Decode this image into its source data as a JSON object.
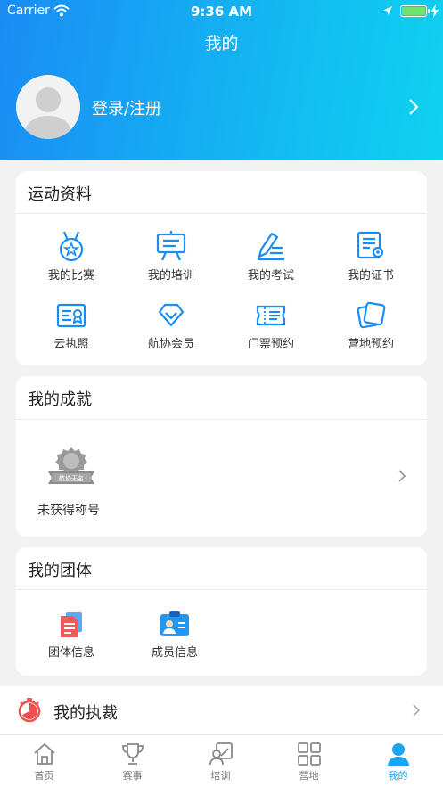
{
  "status_bar": {
    "carrier": "Carrier",
    "time": "9:36 AM"
  },
  "header": {
    "title": "我的",
    "login_label": "登录/注册"
  },
  "sports_profile": {
    "title": "运动资料",
    "items": [
      {
        "label": "我的比赛",
        "icon": "medal-icon"
      },
      {
        "label": "我的培训",
        "icon": "training-board-icon"
      },
      {
        "label": "我的考试",
        "icon": "exam-pen-icon"
      },
      {
        "label": "我的证书",
        "icon": "certificate-icon"
      },
      {
        "label": "云执照",
        "icon": "license-icon"
      },
      {
        "label": "航协会员",
        "icon": "diamond-icon"
      },
      {
        "label": "门票预约",
        "icon": "ticket-icon"
      },
      {
        "label": "营地预约",
        "icon": "camp-cards-icon"
      }
    ]
  },
  "achievements": {
    "title": "我的成就",
    "status": "未获得称号",
    "badge_text": "航协无名"
  },
  "group": {
    "title": "我的团体",
    "items": [
      {
        "label": "团体信息",
        "icon": "group-document-icon"
      },
      {
        "label": "成员信息",
        "icon": "member-card-icon"
      }
    ]
  },
  "referee": {
    "label": "我的执裁",
    "icon": "referee-timer-icon"
  },
  "tabbar": {
    "active": "我的",
    "items": [
      {
        "label": "首页",
        "icon": "home-icon"
      },
      {
        "label": "赛事",
        "icon": "trophy-icon"
      },
      {
        "label": "培训",
        "icon": "trainer-icon"
      },
      {
        "label": "营地",
        "icon": "camp-grid-icon"
      },
      {
        "label": "我的",
        "icon": "user-icon"
      }
    ]
  },
  "colors": {
    "accent": "#1a8cf5",
    "header_end": "#0fd2f0",
    "tab_active": "#1aa6f0",
    "referee_red": "#f05050"
  }
}
